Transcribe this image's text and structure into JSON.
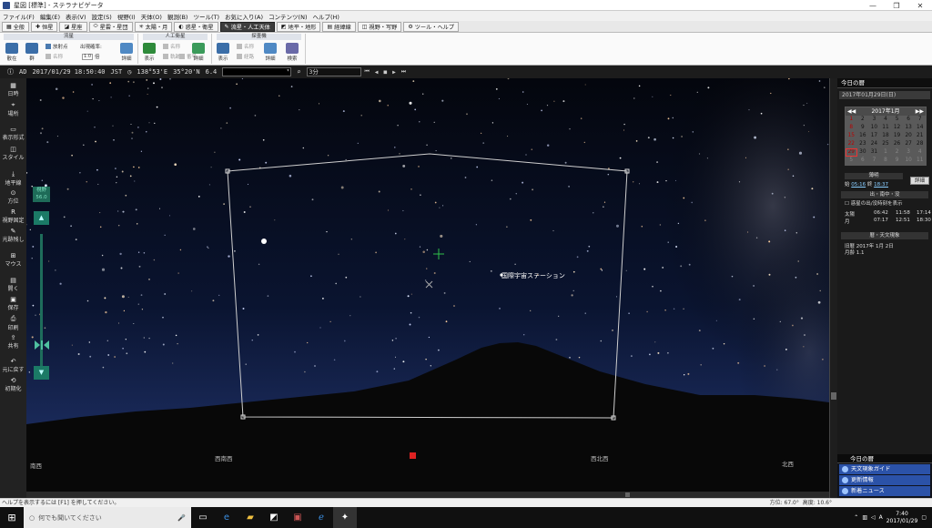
{
  "window": {
    "title": "星図 [標準] - ステラナビゲータ",
    "controls": [
      "—",
      "❐",
      "✕"
    ]
  },
  "menu": [
    "ファイル(F)",
    "編集(E)",
    "表示(V)",
    "設定(S)",
    "視野(I)",
    "天体(O)",
    "観測(B)",
    "ツール(T)",
    "お気に入り(A)",
    "コンテンツ(N)",
    "ヘルプ(H)"
  ],
  "tabs": [
    {
      "label": "全般",
      "icon": "grid-icon"
    },
    {
      "label": "恒星",
      "icon": "plus-icon"
    },
    {
      "label": "星座",
      "icon": "chart-icon"
    },
    {
      "label": "星雲・星団",
      "icon": "ellipse-icon"
    },
    {
      "label": "太陽・月",
      "icon": "sun-icon"
    },
    {
      "label": "惑星・衛星",
      "icon": "planet-icon"
    },
    {
      "label": "流星・人工天体",
      "icon": "meteor-icon",
      "active": true
    },
    {
      "label": "地平・地形",
      "icon": "mountain-icon"
    },
    {
      "label": "経緯線",
      "icon": "grid-lines-icon"
    },
    {
      "label": "視野・写野",
      "icon": "camera-icon"
    },
    {
      "label": "ツール・ヘルプ",
      "icon": "gear-icon"
    }
  ],
  "ribbon": {
    "meteor": {
      "head": "流星",
      "b1": "散在",
      "b2": "群",
      "radiant": "放射点",
      "name": "名称",
      "rate_label": "出現確率:",
      "rate_value": "1.0",
      "rate_unit": "倍"
    },
    "meteor_detail": "詳細",
    "satellite": {
      "head": "人工衛星",
      "show": "表示",
      "name": "名称",
      "number": "番号",
      "trail": "軌跡",
      "detail": "詳細"
    },
    "probe": {
      "head": "探査機",
      "show": "表示",
      "name": "名称",
      "trail": "経路",
      "detail": "詳細",
      "search": "検索"
    }
  },
  "infobar": {
    "era": "AD",
    "datetime": "2017/01/29 18:50:40",
    "tz": "JST",
    "lon": "138°53'E",
    "lat": "35°20'N",
    "mag": "6.4",
    "interval": "3分",
    "controls": [
      "⏮",
      "◀",
      "■",
      "▶",
      "⏭"
    ]
  },
  "left_sidebar": [
    {
      "label": "日時",
      "glyph": "▦"
    },
    {
      "label": "場所",
      "glyph": "⌖"
    },
    {
      "label": "表示形式",
      "glyph": "▭"
    },
    {
      "label": "スタイル",
      "glyph": "◫"
    },
    {
      "label": "地平線",
      "glyph": "⤓"
    },
    {
      "label": "方位",
      "glyph": "⊙"
    },
    {
      "label": "視野固定",
      "glyph": "R"
    },
    {
      "label": "光跡残し",
      "glyph": "✎"
    },
    {
      "label": "マウス",
      "glyph": "⊞"
    },
    {
      "label": "開く",
      "glyph": "▤"
    },
    {
      "label": "保存",
      "glyph": "▣"
    },
    {
      "label": "印刷",
      "glyph": "⎙"
    },
    {
      "label": "共有",
      "glyph": "⇪"
    },
    {
      "label": "元に戻す",
      "glyph": "↶"
    },
    {
      "label": "初期化",
      "glyph": "⟲"
    }
  ],
  "zoom": {
    "label": "視野",
    "value": "56.0",
    "up": "▲",
    "down": "▼",
    "level": 0.84
  },
  "sky": {
    "issl_label": "国際宇宙ステーション",
    "directions": [
      "南西",
      "西南西",
      "西北西",
      "北西"
    ]
  },
  "right_panel": {
    "head": "今日の暦",
    "date": "2017年01月29日(日)",
    "calendar": {
      "month": "2017年1月",
      "prev": "◀◀",
      "next": "▶▶",
      "days": [
        "1",
        "2",
        "3",
        "4",
        "5",
        "6",
        "7",
        "8",
        "9",
        "10",
        "11",
        "12",
        "13",
        "14",
        "15",
        "16",
        "17",
        "18",
        "19",
        "20",
        "21",
        "22",
        "23",
        "24",
        "25",
        "26",
        "27",
        "28",
        "29",
        "30",
        "31",
        "1",
        "2",
        "3",
        "4",
        "5",
        "6",
        "7",
        "8",
        "9",
        "10",
        "11"
      ]
    },
    "twilight_head": "薄明",
    "twilight_start_label": "始",
    "twilight_start": "05:16",
    "twilight_end_label": "終",
    "twilight_end": "18:37",
    "detail": "詳細",
    "rise_set_head": "出・南中・没",
    "planet_check": "惑星の出/没時刻を表示",
    "sun": {
      "name": "太陽",
      "rise": "06:42",
      "transit": "11:58",
      "set": "17:14"
    },
    "moon": {
      "name": "月",
      "rise": "07:17",
      "transit": "12:51",
      "set": "18:30"
    },
    "calendar_head": "暦・天文現象",
    "old_calendar": "旧暦  2017年  1月  2日",
    "moon_age": "月齢 1.1"
  },
  "news": {
    "head": "今日の暦",
    "items": [
      "天文現象ガイド",
      "更新情報",
      "新着ニュース"
    ]
  },
  "status": {
    "help": "ヘルプを表示するには [F1] を押してください。",
    "azimuth": "方位: 67.0°",
    "altitude": "高度: 10.6°"
  },
  "taskbar": {
    "search_placeholder": "何でも聞いてください",
    "time": "7:40",
    "date": "2017/01/29"
  }
}
